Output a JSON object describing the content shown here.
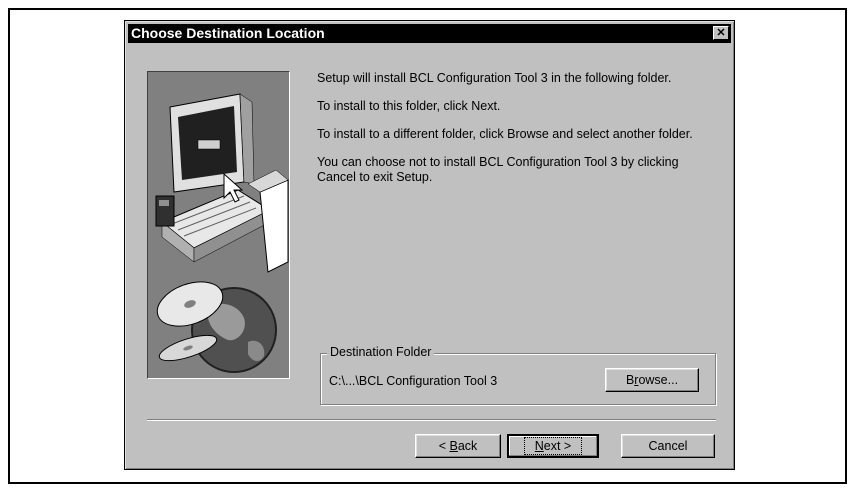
{
  "dialog": {
    "title": "Choose Destination Location",
    "close_symbol": "✕"
  },
  "body_text": [
    "Setup will install BCL Configuration Tool 3 in the following folder.",
    "To install to this folder, click Next.",
    "To install to a different folder, click Browse and select another folder.",
    "You can choose not to install BCL Configuration Tool 3 by clicking Cancel to exit Setup."
  ],
  "destination": {
    "group_label": "Destination Folder",
    "path": "C:\\...\\BCL Configuration Tool 3",
    "browse_pre": "B",
    "browse_u": "r",
    "browse_post": "owse..."
  },
  "buttons": {
    "back_pre": "< ",
    "back_u": "B",
    "back_post": "ack",
    "next_u": "N",
    "next_post": "ext >",
    "cancel": "Cancel"
  },
  "icons": {
    "illustration": "computer-and-cd-globe-illustration",
    "close": "close-icon"
  }
}
